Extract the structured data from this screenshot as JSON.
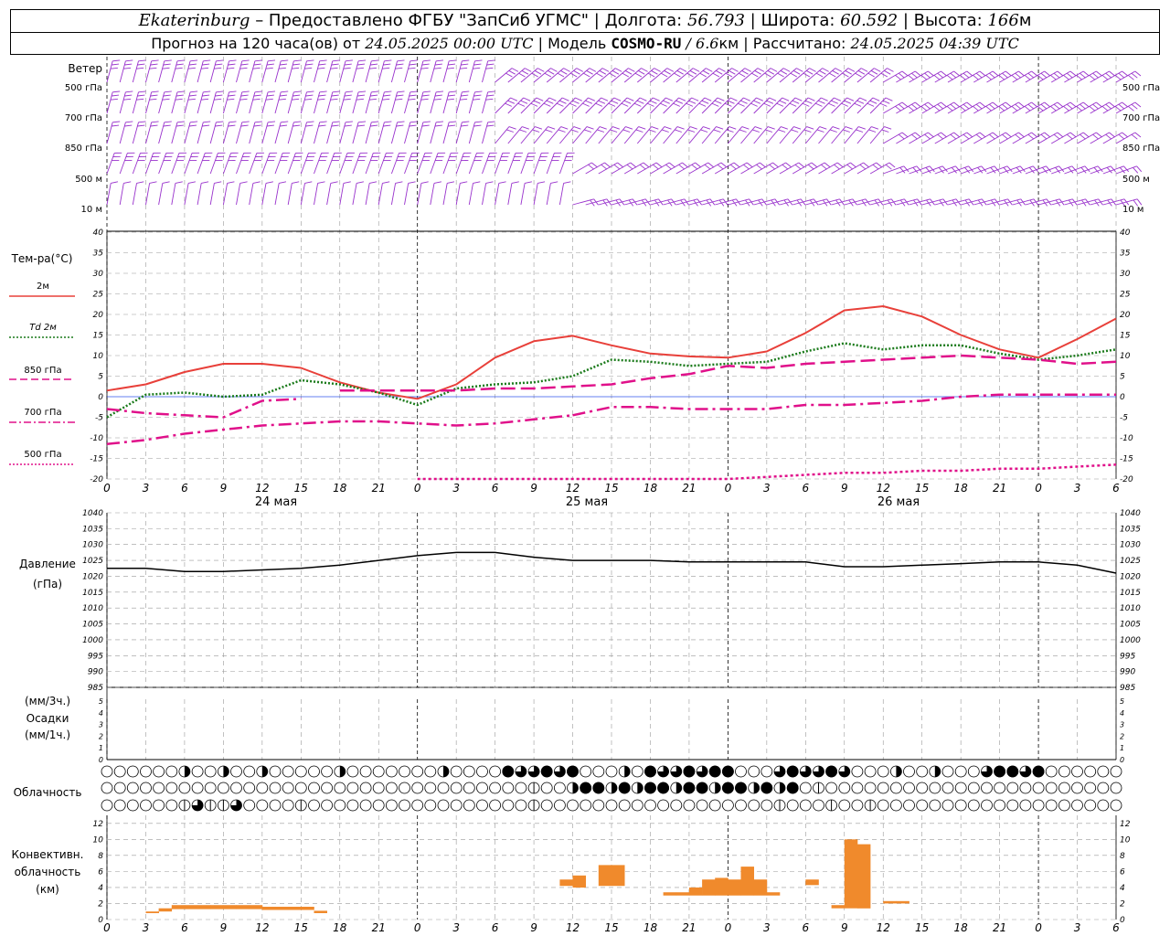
{
  "header": {
    "station": "Ekaterinburg",
    "provider": "– Предоставлено ФГБУ \"ЗапСиб УГМС\" |",
    "lon_label": "Долгота:",
    "lon": "56.793",
    "lat_label": "| Широта:",
    "lat": "60.592",
    "alt_label": "| Высота:",
    "alt": "166",
    "alt_unit": "м",
    "forecast_label": "Прогноз на 120 часа(ов) от",
    "forecast_start": "24.05.2025 00:00 UTC",
    "model_label": "| Модель",
    "model": "COSMO-RU",
    "resolution": "/ 6.6",
    "res_unit": "км",
    "calc_label": "| Рассчитано:",
    "calc_time": "24.05.2025 04:39 UTC"
  },
  "x_axis": {
    "hour_ticks": [
      "0",
      "3",
      "6",
      "9",
      "12",
      "15",
      "18",
      "21",
      "0",
      "3",
      "6",
      "9",
      "12",
      "15",
      "18",
      "21",
      "0",
      "3",
      "6",
      "9",
      "12",
      "15",
      "18",
      "21",
      "0",
      "3",
      "6"
    ],
    "day_labels": [
      "24 мая",
      "25 мая",
      "26 мая"
    ]
  },
  "wind_panel": {
    "title": "Ветер",
    "levels": [
      "500 гПа",
      "700 гПа",
      "850 гПа",
      "500 м",
      "10  м"
    ],
    "color": "#9932cc"
  },
  "temp_panel": {
    "title": "Тем-ра(°C)",
    "legend": [
      {
        "label": "2м",
        "color": "#e8403a",
        "style": "solid"
      },
      {
        "label": "Td  2м",
        "color": "#1a7a1a",
        "style": "dotted"
      },
      {
        "label": "850 гПа",
        "color": "#e0108a",
        "style": "dash"
      },
      {
        "label": "700 гПа",
        "color": "#e0108a",
        "style": "dashdot"
      },
      {
        "label": "500 гПа",
        "color": "#e0108a",
        "style": "dot"
      }
    ]
  },
  "pressure_panel": {
    "title": "Давление",
    "unit": "(гПа)"
  },
  "precip_panel": {
    "label1": "(мм/3ч.)",
    "label2": "Осадки",
    "label3": "(мм/1ч.)"
  },
  "cloud_panel": {
    "title": "Облачность"
  },
  "conv_panel": {
    "label1": "Конвективн.",
    "label2": "облачность",
    "label3": "(км)",
    "bar_color": "#f08a2c"
  },
  "chart_data": [
    {
      "type": "line",
      "name": "temperature",
      "ylim": [
        -20,
        40
      ],
      "yticks": [
        -20,
        -15,
        -10,
        -5,
        0,
        5,
        10,
        15,
        20,
        25,
        30,
        35,
        40
      ],
      "x_hours": [
        0,
        3,
        6,
        9,
        12,
        15,
        18,
        21,
        24,
        27,
        30,
        33,
        36,
        39,
        42,
        45,
        48,
        51,
        54,
        57,
        60,
        63,
        66,
        69,
        72,
        75,
        78
      ],
      "series": [
        {
          "name": "2м",
          "values": [
            1.5,
            3.0,
            6.0,
            8.0,
            8.0,
            7.0,
            3.5,
            1.0,
            -0.5,
            3.0,
            9.5,
            13.5,
            14.8,
            12.5,
            10.5,
            9.8,
            9.5,
            11.0,
            15.5,
            21.0,
            22.0,
            19.5,
            15.0,
            11.5,
            9.5,
            14.0,
            19.0
          ]
        },
        {
          "name": "Td  2м",
          "values": [
            -5.0,
            0.5,
            1.0,
            0.0,
            0.5,
            4.0,
            3.0,
            1.0,
            -2.0,
            2.0,
            3.0,
            3.5,
            5.0,
            9.0,
            8.5,
            7.5,
            8.0,
            8.5,
            11.0,
            13.0,
            11.5,
            12.5,
            12.5,
            10.5,
            9.0,
            10.0,
            11.5
          ]
        },
        {
          "name": "850 гПа",
          "values": [
            null,
            null,
            null,
            null,
            null,
            null,
            1.5,
            1.5,
            1.5,
            1.5,
            2.0,
            2.0,
            2.5,
            3.0,
            4.5,
            5.5,
            7.5,
            7.0,
            8.0,
            8.5,
            9.0,
            9.5,
            10.0,
            9.5,
            9.0,
            8.0,
            8.5
          ]
        },
        {
          "name": "700 гПа",
          "values": [
            -3.0,
            -4.0,
            -4.5,
            -5.0,
            -1.0,
            -0.5,
            null,
            null,
            null,
            null,
            null,
            null,
            -4.5,
            -2.5,
            -2.5,
            -3.0,
            -3.0,
            -3.0,
            -2.0,
            -2.0,
            -1.5,
            -1.0,
            0.0,
            0.5,
            0.5,
            0.5,
            0.5
          ]
        },
        {
          "name": "700 гПа нижн.",
          "values": [
            -11.5,
            -10.5,
            -9.0,
            -8.0,
            -7.0,
            -6.5,
            -6.0,
            -6.0,
            -6.5,
            -7.0,
            -6.5,
            -5.5,
            -4.5,
            null,
            null,
            null,
            null,
            null,
            null,
            null,
            null,
            null,
            null,
            null,
            null,
            null,
            null
          ]
        },
        {
          "name": "500 гПа",
          "values": [
            null,
            null,
            null,
            null,
            null,
            null,
            null,
            null,
            -20.0,
            -20.0,
            -20.0,
            -20.0,
            -20.0,
            -20.0,
            -20.0,
            -20.0,
            -20.0,
            -19.5,
            -19.0,
            -18.5,
            -18.5,
            -18.0,
            -18.0,
            -17.5,
            -17.5,
            -17.0,
            -16.5
          ]
        }
      ]
    },
    {
      "type": "line",
      "name": "pressure",
      "ylim": [
        985,
        1040
      ],
      "yticks": [
        985,
        990,
        995,
        1000,
        1005,
        1010,
        1015,
        1020,
        1025,
        1030,
        1035,
        1040
      ],
      "x_hours": [
        0,
        3,
        6,
        9,
        12,
        15,
        18,
        21,
        24,
        27,
        30,
        33,
        36,
        39,
        42,
        45,
        48,
        51,
        54,
        57,
        60,
        63,
        66,
        69,
        72,
        75,
        78
      ],
      "series": [
        {
          "name": "Давление",
          "values": [
            1022.5,
            1022.5,
            1021.5,
            1021.5,
            1022.0,
            1022.5,
            1023.5,
            1025.0,
            1026.5,
            1027.5,
            1027.5,
            1026.0,
            1025.0,
            1025.0,
            1025.0,
            1024.5,
            1024.5,
            1024.5,
            1024.5,
            1023.0,
            1023.0,
            1023.5,
            1024.0,
            1024.5,
            1024.5,
            1023.5,
            1021.0
          ]
        }
      ]
    },
    {
      "type": "bar",
      "name": "Конвективн. облачность",
      "ylim": [
        0,
        13
      ],
      "yticks": [
        0,
        2,
        4,
        6,
        8,
        10,
        12
      ],
      "bars": [
        {
          "x": 3.5,
          "base": 0.8,
          "top": 1.0
        },
        {
          "x": 4.5,
          "base": 1.0,
          "top": 1.4
        },
        {
          "x": 5.5,
          "base": 1.3,
          "top": 1.8
        },
        {
          "x": 6.5,
          "base": 1.3,
          "top": 1.8
        },
        {
          "x": 7.5,
          "base": 1.3,
          "top": 1.8
        },
        {
          "x": 8.5,
          "base": 1.3,
          "top": 1.8
        },
        {
          "x": 9.5,
          "base": 1.3,
          "top": 1.8
        },
        {
          "x": 10.5,
          "base": 1.3,
          "top": 1.8
        },
        {
          "x": 11.5,
          "base": 1.3,
          "top": 1.8
        },
        {
          "x": 12.5,
          "base": 1.2,
          "top": 1.6
        },
        {
          "x": 13.5,
          "base": 1.2,
          "top": 1.6
        },
        {
          "x": 14.5,
          "base": 1.2,
          "top": 1.6
        },
        {
          "x": 15.5,
          "base": 1.2,
          "top": 1.6
        },
        {
          "x": 16.5,
          "base": 0.8,
          "top": 1.1
        },
        {
          "x": 35.5,
          "base": 4.2,
          "top": 5.0
        },
        {
          "x": 36.5,
          "base": 4.0,
          "top": 5.5
        },
        {
          "x": 38.5,
          "base": 4.2,
          "top": 6.8
        },
        {
          "x": 39.5,
          "base": 4.2,
          "top": 6.8
        },
        {
          "x": 43.5,
          "base": 3.0,
          "top": 3.4
        },
        {
          "x": 44.5,
          "base": 3.0,
          "top": 3.4
        },
        {
          "x": 45.5,
          "base": 3.0,
          "top": 4.0
        },
        {
          "x": 46.5,
          "base": 3.0,
          "top": 5.0
        },
        {
          "x": 47.5,
          "base": 3.0,
          "top": 5.2
        },
        {
          "x": 48.5,
          "base": 3.0,
          "top": 5.0
        },
        {
          "x": 49.5,
          "base": 3.0,
          "top": 6.6
        },
        {
          "x": 50.5,
          "base": 3.0,
          "top": 5.0
        },
        {
          "x": 51.5,
          "base": 3.0,
          "top": 3.4
        },
        {
          "x": 54.5,
          "base": 4.3,
          "top": 5.0
        },
        {
          "x": 56.5,
          "base": 1.4,
          "top": 1.8
        },
        {
          "x": 57.5,
          "base": 1.4,
          "top": 10.0
        },
        {
          "x": 58.5,
          "base": 1.4,
          "top": 9.4
        },
        {
          "x": 60.5,
          "base": 2.0,
          "top": 2.3
        },
        {
          "x": 61.5,
          "base": 2.0,
          "top": 2.3
        }
      ]
    },
    {
      "type": "bar",
      "name": "Осадки",
      "ylim": [
        0,
        5
      ],
      "yticks": [
        0,
        1,
        2,
        3,
        4,
        5
      ],
      "values": []
    }
  ]
}
